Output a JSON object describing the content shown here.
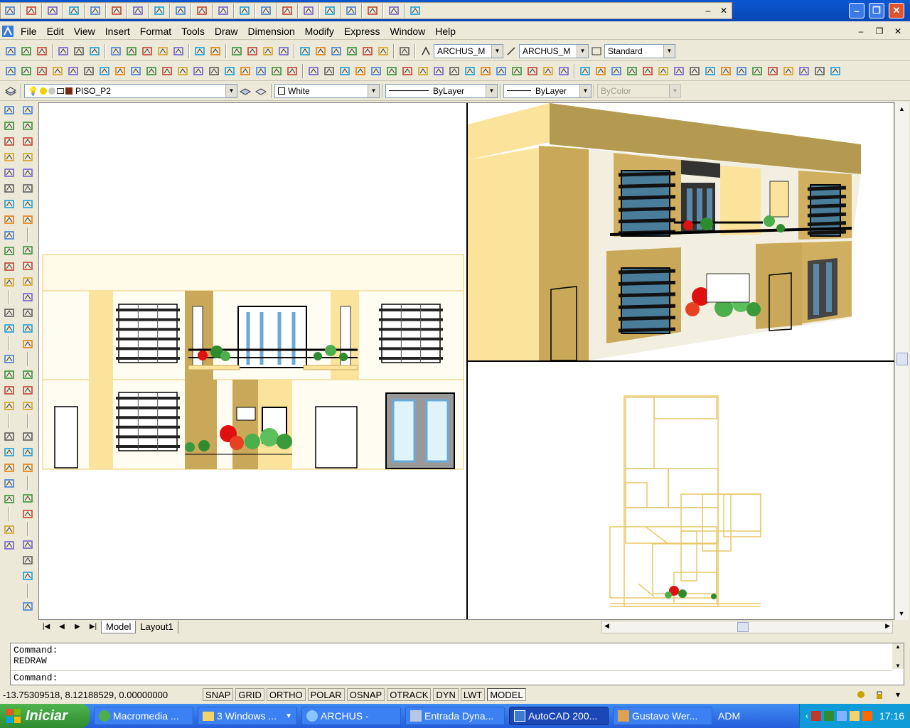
{
  "menu": [
    "File",
    "Edit",
    "View",
    "Insert",
    "Format",
    "Tools",
    "Draw",
    "Dimension",
    "Modify",
    "Express",
    "Window",
    "Help"
  ],
  "styles": {
    "text_style": "ARCHUS_M",
    "dim_style": "ARCHUS_M",
    "table_style": "Standard"
  },
  "layers": {
    "current": "PISO_P2",
    "color": "White",
    "linetype": "ByLayer",
    "lineweight": "ByLayer",
    "plotstyle": "ByColor"
  },
  "tabs": {
    "model": "Model",
    "layout": "Layout1"
  },
  "command": {
    "line1": "Command:",
    "line2": "REDRAW",
    "prompt": "Command:"
  },
  "status": {
    "coords": "-13.75309518, 8.12188529, 0.00000000",
    "toggles": [
      "SNAP",
      "GRID",
      "ORTHO",
      "POLAR",
      "OSNAP",
      "OTRACK",
      "DYN",
      "LWT",
      "MODEL"
    ]
  },
  "taskbar": {
    "start": "Iniciar",
    "items": [
      {
        "label": "Macromedia ..."
      },
      {
        "label": "3 Windows ...",
        "count": "3"
      },
      {
        "label": "ARCHUS -"
      },
      {
        "label": "Entrada Dyna..."
      },
      {
        "label": "AutoCAD 200..."
      },
      {
        "label": "Gustavo Wer..."
      }
    ],
    "lang": "ADM",
    "clock": "17:16"
  },
  "colors": {
    "titlebar": "#0a57d0",
    "wall": "#fbe39c",
    "wall_dark": "#c9a85a",
    "taskbar": "#245edb",
    "start": "#3c9b3c"
  }
}
